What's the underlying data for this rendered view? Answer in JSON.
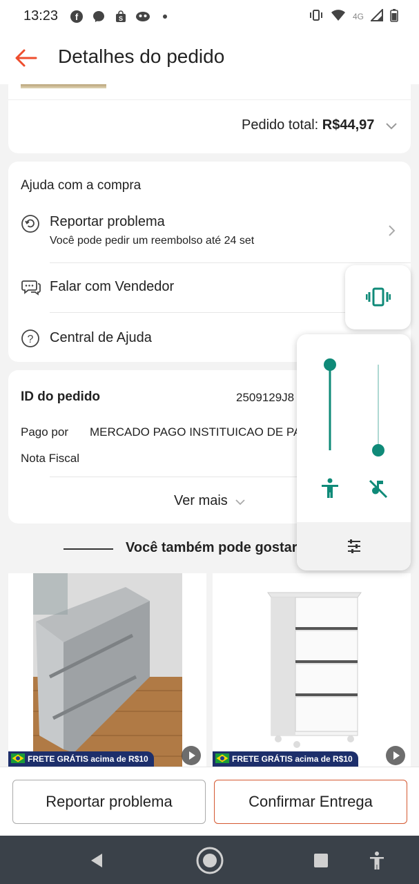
{
  "status_bar": {
    "time": "13:23",
    "network": "4G",
    "icons": [
      "facebook-icon",
      "messenger-icon",
      "shopping-bag-icon",
      "face-icon",
      "dot-icon",
      "vibrate-icon",
      "wifi-icon",
      "signal-icon",
      "battery-icon"
    ]
  },
  "header": {
    "title": "Detalhes do pedido",
    "back_icon": "arrow-left-icon",
    "accent": "#ee4d2d"
  },
  "order_total": {
    "label": "Pedido total: ",
    "value": "R$44,97"
  },
  "help": {
    "title": "Ajuda com a compra",
    "items": [
      {
        "label": "Reportar problema",
        "sub": "Você pode pedir um reembolso até 24 set",
        "icon": "return-icon"
      },
      {
        "label": "Falar com Vendedor",
        "icon": "chat-icon"
      },
      {
        "label": "Central de Ajuda",
        "icon": "help-icon"
      }
    ]
  },
  "order": {
    "id_label": "ID do pedido",
    "id_value": "2509129J8",
    "paid_label": "Pago por",
    "paid_value": "MERCADO PAGO INSTITUICAO DE PA",
    "invoice_label": "Nota Fiscal",
    "see_more": "Ver mais"
  },
  "recommendations": {
    "title": "Você também pode gostar",
    "products": [
      {
        "badge": "FRETE GRÁTIS acima de R$10"
      },
      {
        "badge": "FRETE GRÁTIS acima de R$10"
      }
    ]
  },
  "actions": {
    "report": "Reportar problema",
    "confirm": "Confirmar Entrega"
  },
  "volume_panel": {
    "accent": "#0f8a78",
    "mode_icon": "vibrate-icon",
    "accessibility_level": 1.0,
    "media_level": 0.0
  }
}
